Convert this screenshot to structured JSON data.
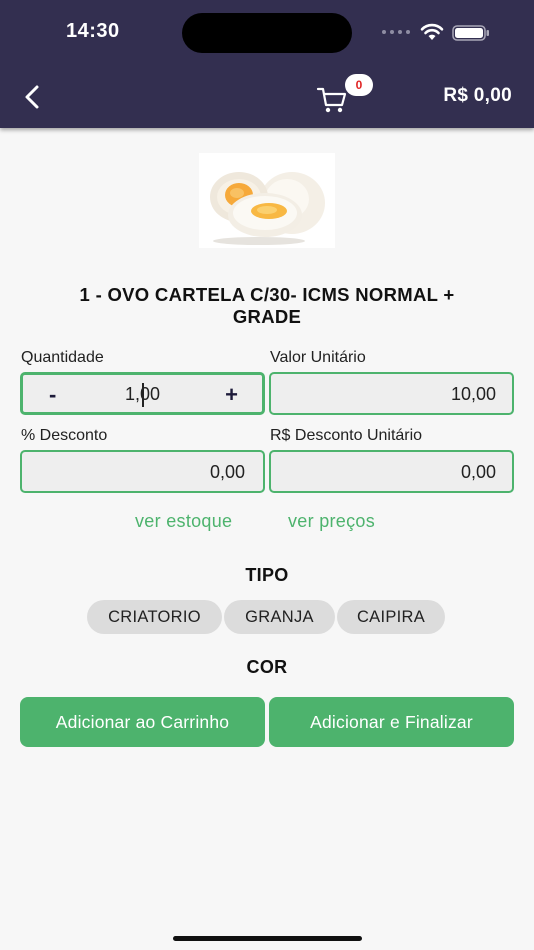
{
  "status_bar": {
    "time": "14:30"
  },
  "header": {
    "cart_count": "0",
    "total": "R$ 0,00"
  },
  "product": {
    "image_icon": "boiled-eggs-image",
    "title_line1": "1 - OVO CARTELA C/30- ICMS NORMAL +",
    "title_line2": "GRADE"
  },
  "form": {
    "quantity_label": "Quantidade",
    "quantity_value": "1,00",
    "quantity_minus": "-",
    "quantity_plus": "+",
    "unit_price_label": "Valor Unitário",
    "unit_price_value": "10,00",
    "discount_pct_label": "% Desconto",
    "discount_pct_value": "0,00",
    "discount_unit_label": "R$ Desconto Unitário",
    "discount_unit_value": "0,00"
  },
  "links": {
    "stock": "ver estoque",
    "prices": "ver preços"
  },
  "tipo": {
    "title": "TIPO",
    "options": [
      "CRIATORIO",
      "GRANJA",
      "CAIPIRA"
    ]
  },
  "cor": {
    "title": "COR"
  },
  "actions": {
    "add_to_cart": "Adicionar ao Carrinho",
    "add_and_finish": "Adicionar e Finalizar"
  },
  "colors": {
    "header": "#332f50",
    "accent": "#4db36d",
    "badge_text": "#e02424"
  }
}
